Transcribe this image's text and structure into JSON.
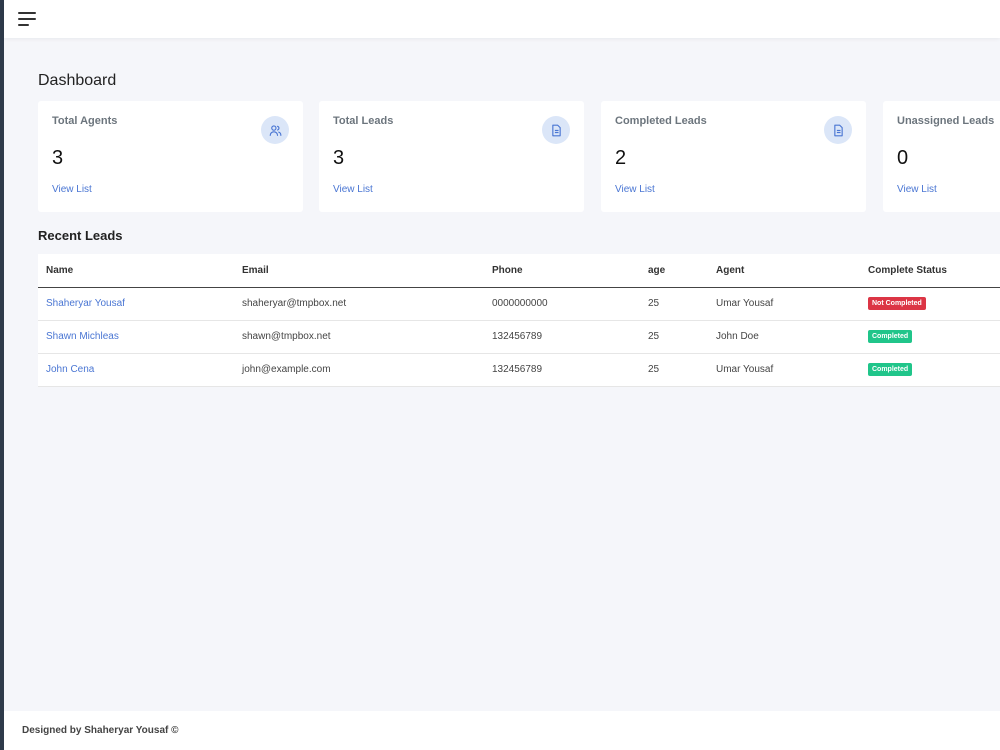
{
  "header": {
    "menu_icon": "hamburger-menu-icon"
  },
  "page": {
    "title": "Dashboard"
  },
  "cards": [
    {
      "title": "Total Agents",
      "value": "3",
      "link": "View List",
      "icon": "users-icon"
    },
    {
      "title": "Total Leads",
      "value": "3",
      "link": "View List",
      "icon": "document-icon"
    },
    {
      "title": "Completed Leads",
      "value": "2",
      "link": "View List",
      "icon": "document-icon"
    },
    {
      "title": "Unassigned Leads",
      "value": "0",
      "link": "View List",
      "icon": "document-icon"
    }
  ],
  "recent_leads": {
    "title": "Recent Leads",
    "columns": [
      "Name",
      "Email",
      "Phone",
      "age",
      "Agent",
      "Complete Status"
    ],
    "rows": [
      {
        "name": "Shaheryar Yousaf",
        "email": "shaheryar@tmpbox.net",
        "phone": "0000000000",
        "age": "25",
        "agent": "Umar Yousaf",
        "status": "Not Completed"
      },
      {
        "name": "Shawn Michleas",
        "email": "shawn@tmpbox.net",
        "phone": "132456789",
        "age": "25",
        "agent": "John Doe",
        "status": "Completed"
      },
      {
        "name": "John Cena",
        "email": "john@example.com",
        "phone": "132456789",
        "age": "25",
        "agent": "Umar Yousaf",
        "status": "Completed"
      }
    ]
  },
  "colors": {
    "accent": "#4a76d3",
    "status_not_completed": "#dc3545",
    "status_completed": "#20c58a"
  },
  "footer": {
    "text": "Designed by Shaheryar Yousaf ©"
  }
}
